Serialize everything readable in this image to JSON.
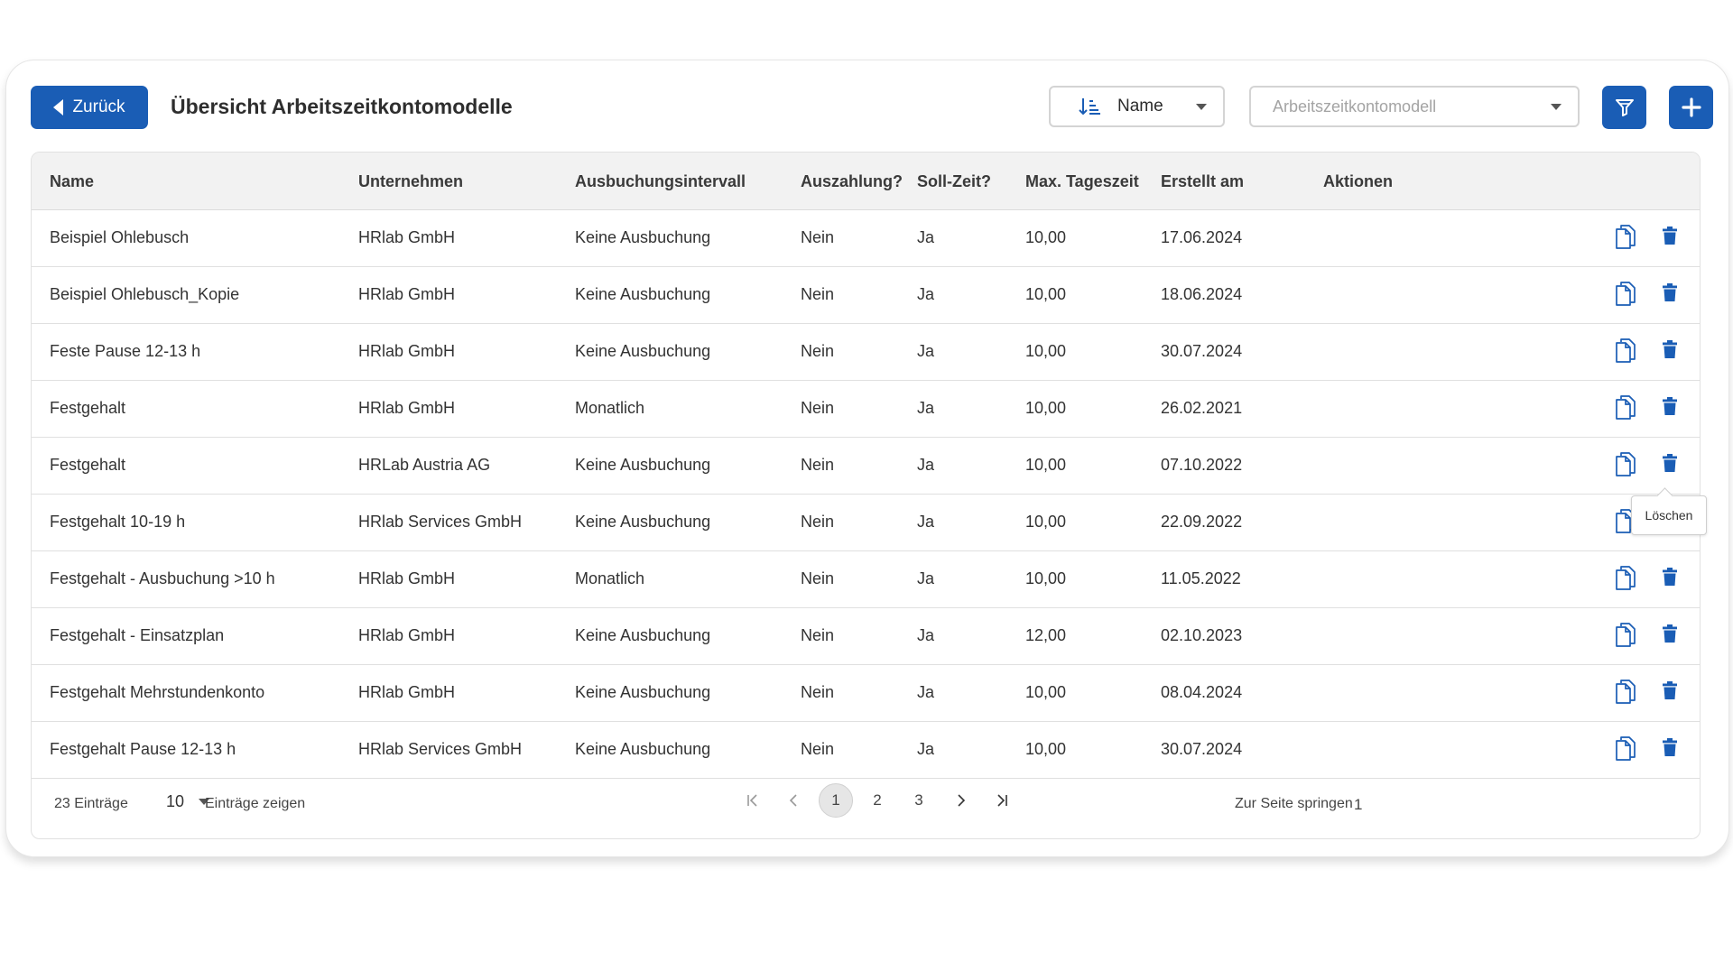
{
  "header": {
    "back_label": "Zurück",
    "title": "Übersicht Arbeitszeitkontomodelle",
    "sort_value": "Name",
    "model_placeholder": "Arbeitszeitkontomodell"
  },
  "table": {
    "columns": [
      "Name",
      "Unternehmen",
      "Ausbuchungsintervall",
      "Auszahlung?",
      "Soll-Zeit?",
      "Max. Tageszeit",
      "Erstellt am",
      "Aktionen"
    ],
    "rows": [
      [
        "Beispiel Ohlebusch",
        "HRlab GmbH",
        "Keine Ausbuchung",
        "Nein",
        "Ja",
        "10,00",
        "17.06.2024"
      ],
      [
        "Beispiel Ohlebusch_Kopie",
        "HRlab GmbH",
        "Keine Ausbuchung",
        "Nein",
        "Ja",
        "10,00",
        "18.06.2024"
      ],
      [
        "Feste Pause 12-13 h",
        "HRlab GmbH",
        "Keine Ausbuchung",
        "Nein",
        "Ja",
        "10,00",
        "30.07.2024"
      ],
      [
        "Festgehalt",
        "HRlab GmbH",
        "Monatlich",
        "Nein",
        "Ja",
        "10,00",
        "26.02.2021"
      ],
      [
        "Festgehalt",
        "HRLab Austria AG",
        "Keine Ausbuchung",
        "Nein",
        "Ja",
        "10,00",
        "07.10.2022"
      ],
      [
        "Festgehalt 10-19 h",
        "HRlab Services GmbH",
        "Keine Ausbuchung",
        "Nein",
        "Ja",
        "10,00",
        "22.09.2022"
      ],
      [
        "Festgehalt - Ausbuchung >10 h",
        "HRlab GmbH",
        "Monatlich",
        "Nein",
        "Ja",
        "10,00",
        "11.05.2022"
      ],
      [
        "Festgehalt - Einsatzplan",
        "HRlab GmbH",
        "Keine Ausbuchung",
        "Nein",
        "Ja",
        "12,00",
        "02.10.2023"
      ],
      [
        "Festgehalt Mehrstundenkonto",
        "HRlab GmbH",
        "Keine Ausbuchung",
        "Nein",
        "Ja",
        "10,00",
        "08.04.2024"
      ],
      [
        "Festgehalt Pause 12-13 h",
        "HRlab Services GmbH",
        "Keine Ausbuchung",
        "Nein",
        "Ja",
        "10,00",
        "30.07.2024"
      ]
    ],
    "tooltip": "Löschen"
  },
  "footer": {
    "entries_count": "23 Einträge",
    "per_page": "10",
    "per_page_label": "Einträge zeigen",
    "pages": [
      "1",
      "2",
      "3"
    ],
    "current_page": "1",
    "jump_label": "Zur Seite springen",
    "jump_value": "1"
  },
  "colors": {
    "primary": "#1a5db5",
    "header_bg": "#f2f2f2"
  },
  "icons": {
    "back": "caret-left-icon",
    "sort": "sort-ascending-icon",
    "filter": "filter-icon",
    "add": "plus-icon",
    "copy": "copy-icon",
    "delete": "trash-icon"
  }
}
